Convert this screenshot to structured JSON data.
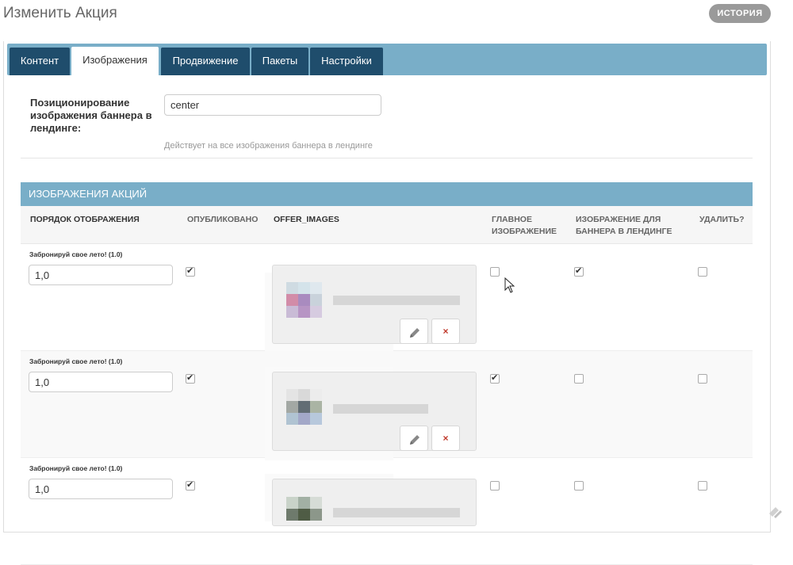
{
  "page": {
    "title": "Изменить Акция",
    "history_label": "ИСТОРИЯ"
  },
  "tabs": [
    {
      "label": "Контент",
      "active": false
    },
    {
      "label": "Изображения",
      "active": true
    },
    {
      "label": "Продвижение",
      "active": false
    },
    {
      "label": "Пакеты",
      "active": false
    },
    {
      "label": "Настройки",
      "active": false
    }
  ],
  "banner_position": {
    "label": "Позиционирование изображения баннера в лендинге:",
    "value": "center",
    "help": "Действует на все изображения баннера в лендинге"
  },
  "inline": {
    "title": "ИЗОБРАЖЕНИЯ АКЦИЙ",
    "columns": [
      "ПОРЯДОК ОТОБРАЖЕНИЯ",
      "ОПУБЛИКОВАНО",
      "OFFER_IMAGES",
      "ГЛАВНОЕ ИЗОБРАЖЕНИЕ",
      "ИЗОБРАЖЕНИЕ ДЛЯ БАННЕРА В ЛЕНДИНГЕ",
      "УДАЛИТЬ?"
    ],
    "rows": [
      {
        "title": "Забронируй свое лето! (1.0)",
        "order": "1,0",
        "published": true,
        "main": false,
        "banner": true,
        "delete": false,
        "delete_btn": "×"
      },
      {
        "title": "Забронируй свое лето! (1.0)",
        "order": "1,0",
        "published": true,
        "main": true,
        "banner": false,
        "delete": false,
        "delete_btn": "×"
      },
      {
        "title": "Забронируй свое лето! (1.0)",
        "order": "1,0",
        "published": true,
        "main": false,
        "banner": false,
        "delete": false,
        "delete_btn": "×"
      }
    ]
  },
  "colors": {
    "accent": "#79aec8",
    "tab_dark": "#1f4d6c",
    "delete": "#c0392b"
  },
  "icons": [
    "pencil-icon",
    "close-icon",
    "mouse-cursor-icon",
    "corner-logo-icon"
  ]
}
